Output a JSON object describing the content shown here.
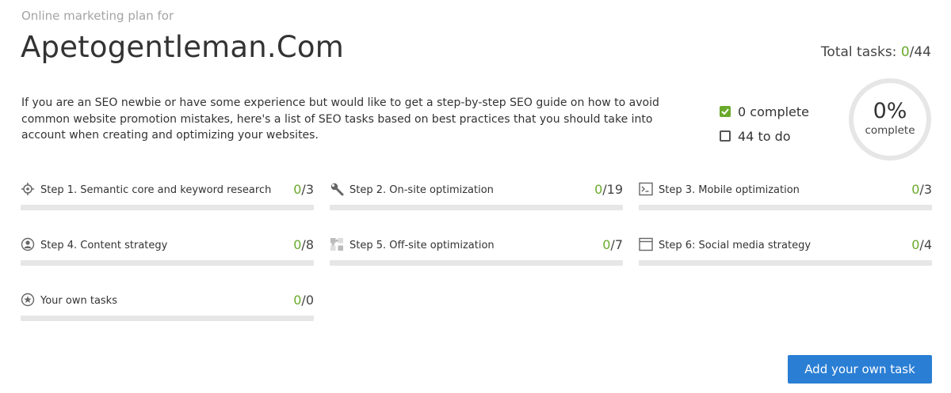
{
  "header": {
    "pre_title": "Online marketing plan for",
    "site_title": "Apetogentleman.Com",
    "total_label": "Total tasks: ",
    "total_done": "0",
    "total_all": "/44"
  },
  "intro": "If you are an SEO newbie or have some experience but would like to get a step-by-step SEO guide on how to avoid common website promotion mistakes, here's a list of SEO tasks based on best practices that you should take into account when creating and optimizing your websites.",
  "legend": {
    "complete_label": "0 complete",
    "todo_label": "44 to do"
  },
  "progress": {
    "percent_text": "0%",
    "label": "complete",
    "fraction": 0
  },
  "colors": {
    "accent_green": "#6aa92b",
    "button_blue": "#2a7ed4",
    "track_gray": "#e6e6e6"
  },
  "steps": [
    {
      "label": "Step 1. Semantic core and keyword research",
      "done": "0",
      "total": "/3",
      "progress": 0,
      "icon": "crosshair-icon"
    },
    {
      "label": "Step 2. On-site optimization",
      "done": "0",
      "total": "/19",
      "progress": 0,
      "icon": "wrench-icon"
    },
    {
      "label": "Step 3. Mobile optimization",
      "done": "0",
      "total": "/3",
      "progress": 0,
      "icon": "terminal-icon"
    },
    {
      "label": "Step 4. Content strategy",
      "done": "0",
      "total": "/8",
      "progress": 0,
      "icon": "user-circle-icon"
    },
    {
      "label": "Step 5. Off-site optimization",
      "done": "0",
      "total": "/7",
      "progress": 0,
      "icon": "puzzle-icon"
    },
    {
      "label": "Step 6: Social media strategy",
      "done": "0",
      "total": "/4",
      "progress": 0,
      "icon": "browser-window-icon"
    },
    {
      "label": "Your own tasks",
      "done": "0",
      "total": "/0",
      "progress": 0,
      "icon": "star-circle-icon"
    }
  ],
  "add_button": "Add your own task"
}
